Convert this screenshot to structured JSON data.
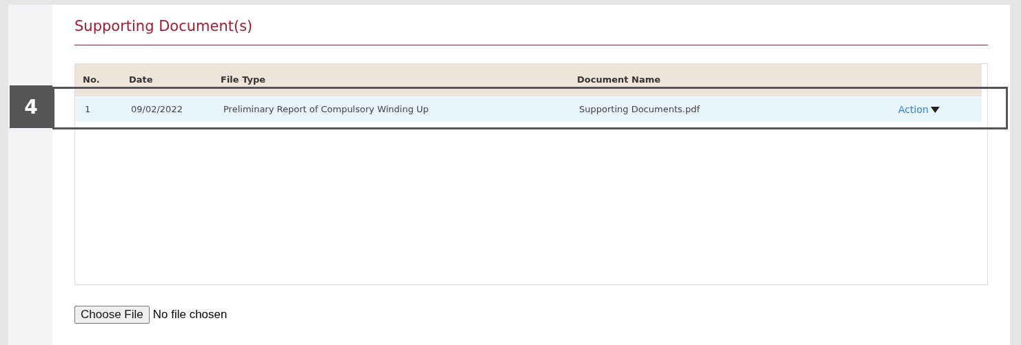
{
  "section_title": "Supporting Document(s)",
  "table": {
    "columns": [
      "No.",
      "Date",
      "File Type",
      "Document Name"
    ],
    "rows": [
      {
        "no": "1",
        "date": "09/02/2022",
        "file_type": "Preliminary Report of Compulsory Winding Up",
        "document_name": "Supporting Documents.pdf",
        "action": "Action",
        "selected": true
      }
    ]
  },
  "file_input": {
    "button": "Choose File",
    "status": "No file chosen"
  },
  "callout": {
    "step": "4"
  }
}
